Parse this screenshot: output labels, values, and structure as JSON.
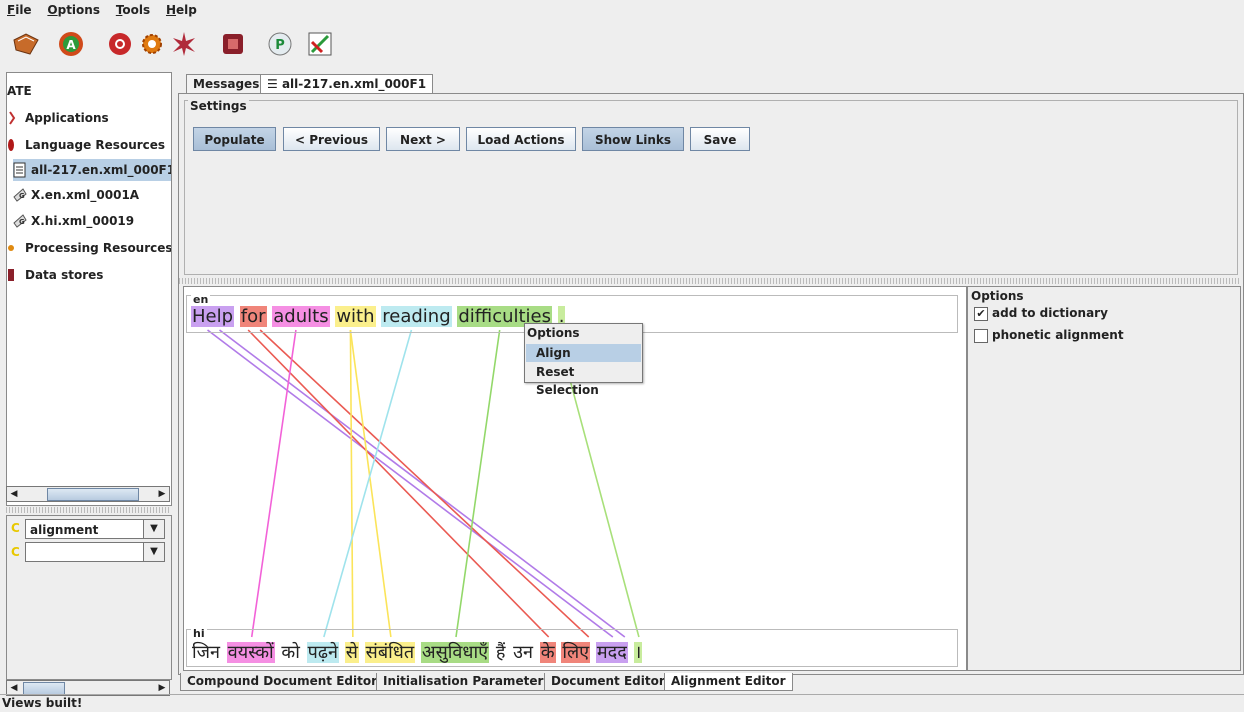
{
  "menu": [
    {
      "label": "File",
      "accel": "F"
    },
    {
      "label": "Options",
      "accel": "O"
    },
    {
      "label": "Tools",
      "accel": "T"
    },
    {
      "label": "Help",
      "accel": "H"
    }
  ],
  "toolbar_icons": [
    "load-application-icon",
    "new-application-icon",
    "new-language-resource-icon",
    "new-processing-resource-icon",
    "new-pipeline-icon",
    "datastore-icon",
    "pause-icon",
    "annotation-diff-icon"
  ],
  "tree": {
    "root": "ATE",
    "applications": "Applications",
    "language_resources": "Language Resources",
    "doc1": "all-217.en.xml_000F1",
    "doc2": "X.en.xml_0001A",
    "doc3": "X.hi.xml_00019",
    "processing_resources": "Processing Resources",
    "data_stores": "Data stores"
  },
  "lower_panel": {
    "combo1": "alignment",
    "combo2": ""
  },
  "top_tabs": [
    "Messages",
    "all-217.en.xml_000F1"
  ],
  "settings": {
    "title": "Settings",
    "buttons": [
      "Populate",
      "< Previous",
      "Next >",
      "Load Actions",
      "Show Links",
      "Save"
    ]
  },
  "alignment": {
    "en_label": "en",
    "hi_label": "hi",
    "en_words": [
      {
        "text": "Help",
        "color": "#c9a0f0"
      },
      {
        "text": "for",
        "color": "#f0857a"
      },
      {
        "text": "adults",
        "color": "#f58fe3"
      },
      {
        "text": "with",
        "color": "#fbef8c"
      },
      {
        "text": "reading",
        "color": "#bdeaf0"
      },
      {
        "text": "difficulties",
        "color": "#a8dc85"
      },
      {
        "text": ".",
        "color": "#c8ec9d"
      }
    ],
    "hi_words": [
      {
        "text": "जिन",
        "color": ""
      },
      {
        "text": "वयस्कों",
        "color": "#f58fe3"
      },
      {
        "text": "को",
        "color": ""
      },
      {
        "text": "पढ़ने",
        "color": "#bdeaf0"
      },
      {
        "text": "से",
        "color": "#fbef8c"
      },
      {
        "text": "संबंधित",
        "color": "#fbef8c"
      },
      {
        "text": "असुविधाएँ",
        "color": "#a8dc85"
      },
      {
        "text": "हैं",
        "color": ""
      },
      {
        "text": "उन",
        "color": ""
      },
      {
        "text": "के",
        "color": "#f0857a"
      },
      {
        "text": "लिए",
        "color": "#f0857a"
      },
      {
        "text": "मदद",
        "color": "#c9a0f0"
      },
      {
        "text": "।",
        "color": "#c8ec9d"
      }
    ]
  },
  "popup": {
    "title": "Options",
    "items": [
      "Align",
      "Reset Selection"
    ]
  },
  "options_pane": {
    "title": "Options",
    "items": [
      {
        "label": "add to dictionary",
        "checked": true
      },
      {
        "label": "phonetic alignment",
        "checked": false
      }
    ]
  },
  "bottom_tabs": [
    "Compound Document Editor",
    "Initialisation Parameters",
    "Document Editor",
    "Alignment Editor"
  ],
  "status": "Views built!"
}
